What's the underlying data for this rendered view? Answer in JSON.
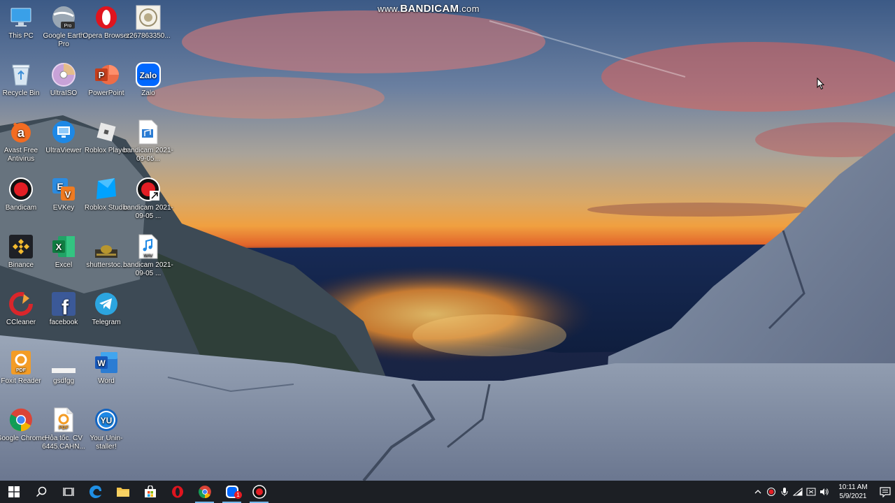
{
  "watermark": {
    "prefix": "www.",
    "brand": "BANDICAM",
    "suffix": ".com"
  },
  "desktop": {
    "icons": [
      {
        "label": "This PC",
        "icon": "this-pc-icon"
      },
      {
        "label": "Google Earth Pro",
        "icon": "google-earth-icon"
      },
      {
        "label": "Opera Browser",
        "icon": "opera-icon"
      },
      {
        "label": "z267863350...",
        "icon": "image-file-icon"
      },
      {
        "label": "Recycle Bin",
        "icon": "recycle-bin-icon"
      },
      {
        "label": "UltraISO",
        "icon": "ultraiso-icon"
      },
      {
        "label": "PowerPoint",
        "icon": "powerpoint-icon"
      },
      {
        "label": "Zalo",
        "icon": "zalo-icon"
      },
      {
        "label": "Avast Free Antivirus",
        "icon": "avast-icon"
      },
      {
        "label": "UltraViewer",
        "icon": "ultraviewer-icon"
      },
      {
        "label": "Roblox Player",
        "icon": "roblox-icon"
      },
      {
        "label": "bandicam 2021-09-05...",
        "icon": "audio-file-icon"
      },
      {
        "label": "Bandicam",
        "icon": "bandicam-icon"
      },
      {
        "label": "EVKey",
        "icon": "evkey-icon"
      },
      {
        "label": "Roblox Studio",
        "icon": "roblox-studio-icon"
      },
      {
        "label": "bandicam 2021-09-05 ...",
        "icon": "bandicam-shortcut-icon"
      },
      {
        "label": "Binance",
        "icon": "binance-icon"
      },
      {
        "label": "Excel",
        "icon": "excel-icon"
      },
      {
        "label": "shutterstoc...",
        "icon": "shutterstock-icon"
      },
      {
        "label": "bandicam 2021-09-05 ...",
        "icon": "wav-file-icon"
      },
      {
        "label": "CCleaner",
        "icon": "ccleaner-icon"
      },
      {
        "label": "facebook",
        "icon": "facebook-icon"
      },
      {
        "label": "Telegram",
        "icon": "telegram-icon"
      },
      {
        "label": "Foxit Reader",
        "icon": "foxit-reader-icon"
      },
      {
        "label": "gsdfgg",
        "icon": "blank-file-icon"
      },
      {
        "label": "Word",
        "icon": "word-icon"
      },
      {
        "label": "Google Chrome",
        "icon": "chrome-icon"
      },
      {
        "label": "Hỏa tốc. CV 6445.CAHN...",
        "icon": "pdf-file-icon"
      },
      {
        "label": "Your Unin-staller!",
        "icon": "uninstaller-icon"
      }
    ],
    "icon_texts": {
      "earth_badge": "Pro",
      "zalo": "Zalo",
      "ppt": "P",
      "avast": "a",
      "excel": "X",
      "word": "W",
      "facebook": "f",
      "pdf": "PDF",
      "wav": "WAV",
      "yu": "YU"
    }
  },
  "taskbar": {
    "buttons": [
      {
        "name": "start-button",
        "icon": "windows-icon"
      },
      {
        "name": "search-button",
        "icon": "search-icon"
      },
      {
        "name": "task-view-button",
        "icon": "task-view-icon"
      },
      {
        "name": "edge-button",
        "icon": "edge-icon"
      },
      {
        "name": "file-explorer-button",
        "icon": "folder-icon"
      },
      {
        "name": "store-button",
        "icon": "store-icon"
      },
      {
        "name": "opera-taskbar-button",
        "icon": "opera-icon"
      },
      {
        "name": "chrome-taskbar-button",
        "icon": "chrome-icon"
      },
      {
        "name": "zalo-taskbar-button",
        "icon": "zalo-icon"
      },
      {
        "name": "bandicam-taskbar-button",
        "icon": "bandicam-icon"
      }
    ],
    "zalo_badge": "1",
    "clock": {
      "time": "10:11 AM",
      "date": "5/9/2021"
    },
    "accent": "#76b9ed"
  }
}
